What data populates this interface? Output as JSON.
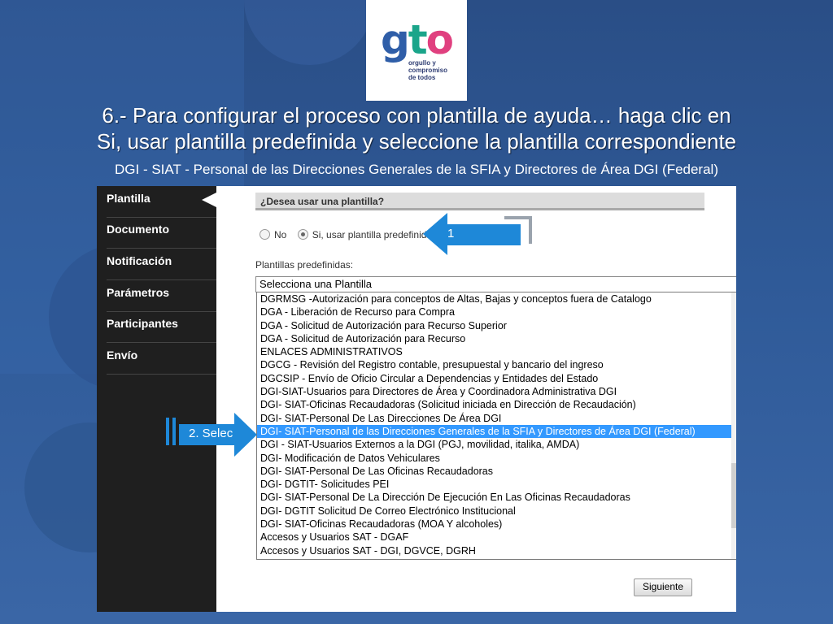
{
  "logo": {
    "text_g": "g",
    "text_t": "t",
    "text_o": "o",
    "tagline_1": "orgullo y",
    "tagline_2": "compromiso",
    "tagline_3": "de todos"
  },
  "slide": {
    "title_line1": "6.- Para configurar el proceso con plantilla de ayuda… haga clic en",
    "title_line2": "Si, usar plantilla predefinida y seleccione la plantilla correspondiente",
    "subtitle": "DGI - SIAT - Personal de las Direcciones Generales de la SFIA y Directores de Área DGI (Federal)"
  },
  "sidebar": {
    "items": [
      {
        "label": "Plantilla"
      },
      {
        "label": "Documento"
      },
      {
        "label": "Notificación"
      },
      {
        "label": "Parámetros"
      },
      {
        "label": "Participantes"
      },
      {
        "label": "Envío"
      }
    ]
  },
  "form": {
    "question": "¿Desea usar una plantilla?",
    "radio_no": "No",
    "radio_yes": "Si, usar plantilla predefinida",
    "selected_radio": "yes",
    "predef_label": "Plantillas predefinidas:",
    "select_value": "Selecciona una Plantilla",
    "options": [
      "DGRMSG -Autorización para conceptos de Altas, Bajas y conceptos fuera de Catalogo",
      "DGA - Liberación de Recurso para Compra",
      "DGA - Solicitud de Autorización para Recurso Superior",
      "DGA - Solicitud de Autorización para Recurso",
      "ENLACES ADMINISTRATIVOS",
      "DGCG - Revisión del Registro contable, presupuestal y bancario del ingreso",
      "DGCSIP - Envío de Oficio Circular a Dependencias y Entidades del Estado",
      "DGI-SIAT-Usuarios para Directores de Área y Coordinadora Administrativa DGI",
      "DGI- SIAT-Oficinas Recaudadoras (Solicitud iniciada en Dirección de Recaudación)",
      "DGI- SIAT-Personal De Las Direcciones De Área DGI",
      "DGI- SIAT-Personal de las Direcciones Generales de la SFIA y Directores de Área DGI (Federal)",
      "DGI - SIAT-Usuarios Externos a la DGI (PGJ, movilidad, italika, AMDA)",
      "DGI- Modificación de Datos Vehiculares",
      "DGI- SIAT-Personal De Las Oficinas Recaudadoras",
      "DGI- DGTIT- Solicitudes PEI",
      "DGI- SIAT-Personal De La Dirección De Ejecución En Las Oficinas Recaudadoras",
      "DGI- DGTIT Solicitud De Correo Electrónico Institucional",
      "DGI- SIAT-Oficinas Recaudadoras (MOA Y alcoholes)",
      "Accesos y Usuarios SAT - DGAF",
      "Accesos y Usuarios SAT - DGI, DGVCE, DGRH"
    ],
    "highlighted_index": 10,
    "next_button": "Siguiente"
  },
  "callouts": {
    "step1": "1",
    "step2": "2. Selec"
  },
  "colors": {
    "callout": "#1e88d8",
    "highlight": "#3399ff",
    "sidebar": "#1f1f1f"
  }
}
